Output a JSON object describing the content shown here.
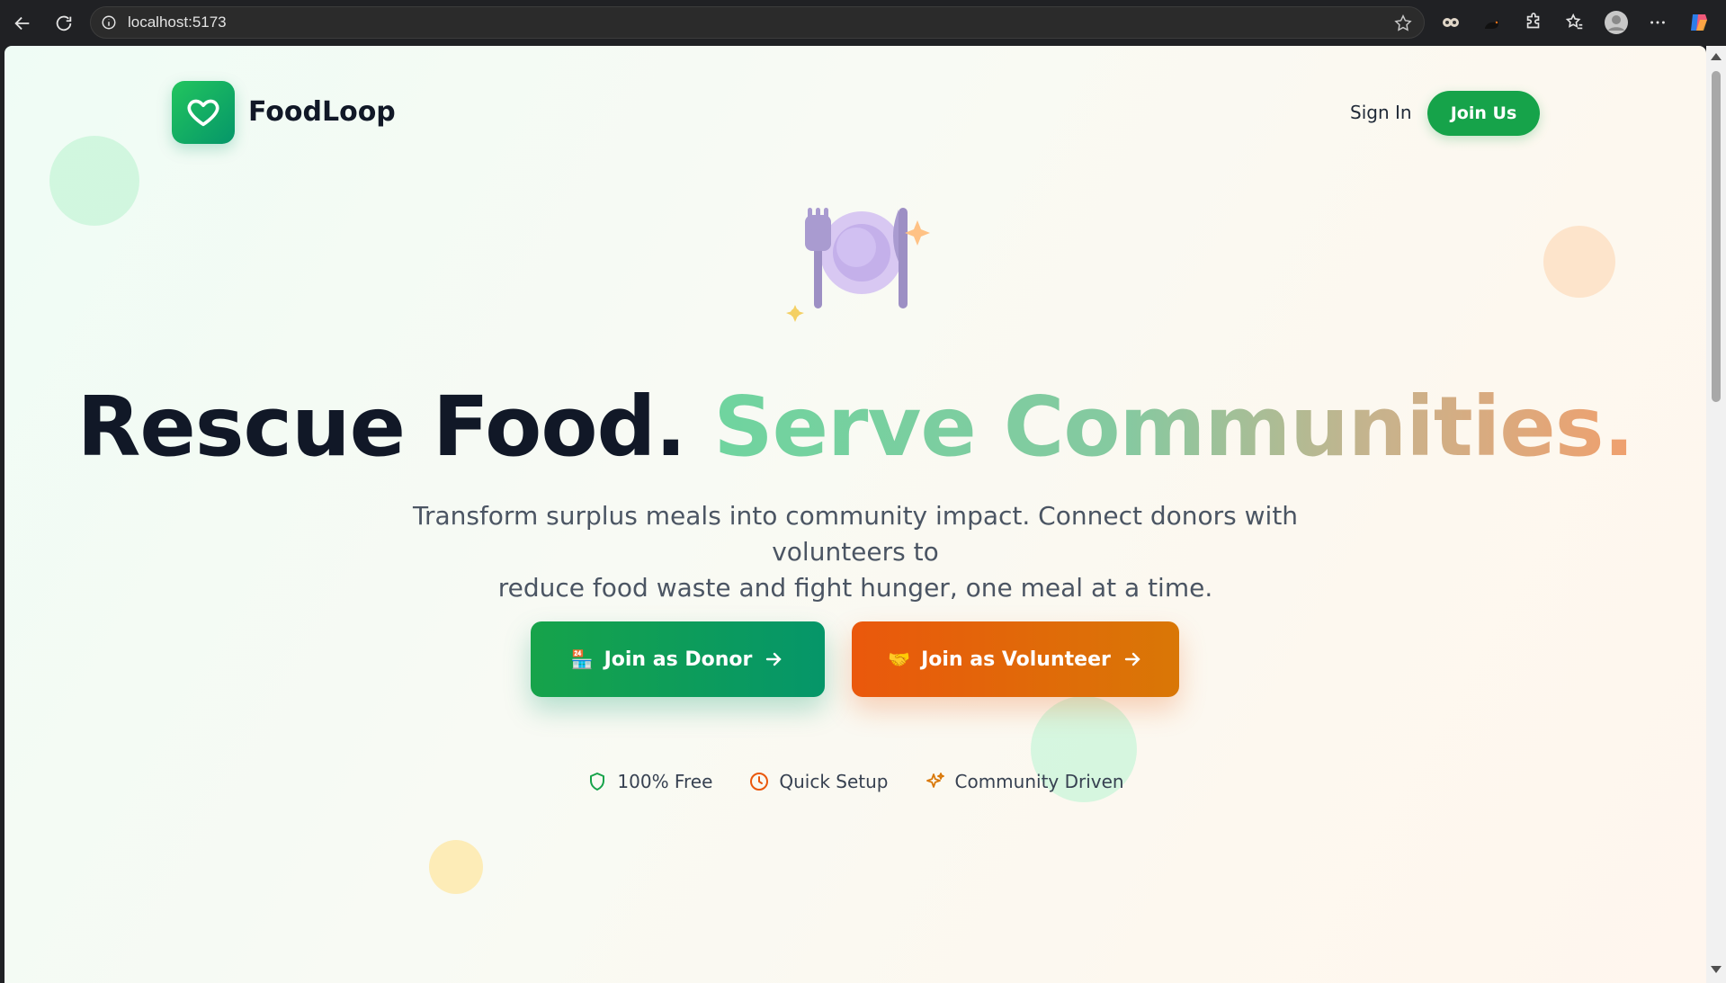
{
  "browser": {
    "url": "localhost:5173"
  },
  "header": {
    "brand": "FoodLoop",
    "signin_label": "Sign In",
    "joinus_label": "Join Us"
  },
  "hero": {
    "headline_dark": "Rescue Food.",
    "headline_gradient": "Serve Communities.",
    "subtitle_line1": "Transform surplus meals into community impact. Connect donors with volunteers to",
    "subtitle_line2": "reduce food waste and fight hunger, one meal at a time.",
    "donor_emoji": "🏪",
    "donor_label": "Join as Donor",
    "volunteer_emoji": "🤝",
    "volunteer_label": "Join as Volunteer"
  },
  "features": [
    {
      "label": "100% Free",
      "icon": "shield-icon",
      "color": "#16a34a"
    },
    {
      "label": "Quick Setup",
      "icon": "clock-icon",
      "color": "#ea580c"
    },
    {
      "label": "Community Driven",
      "icon": "sparkles-icon",
      "color": "#d97706"
    }
  ],
  "colors": {
    "brand_green": "#16a34a",
    "accent_orange": "#ea580c",
    "text_dark": "#111827",
    "text_muted": "#4b5563"
  }
}
